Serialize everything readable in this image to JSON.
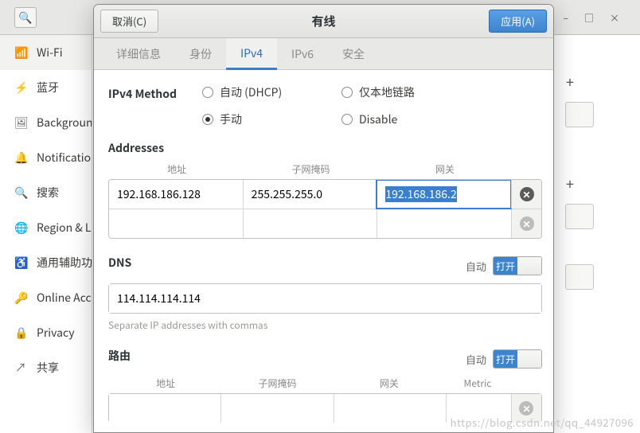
{
  "topbar": {
    "window_controls": {
      "min": "–",
      "max": "□",
      "close": "×"
    }
  },
  "sidebar": {
    "items": [
      {
        "icon": "📶",
        "label": "Wi-Fi"
      },
      {
        "icon": "⚡",
        "label": "蓝牙"
      },
      {
        "icon": "🖼",
        "label": "Background"
      },
      {
        "icon": "🔔",
        "label": "Notifications"
      },
      {
        "icon": "🔍",
        "label": "搜索"
      },
      {
        "icon": "🌐",
        "label": "Region & Language"
      },
      {
        "icon": "♿",
        "label": "通用辅助功能"
      },
      {
        "icon": "🔑",
        "label": "Online Accounts"
      },
      {
        "icon": "🔒",
        "label": "Privacy"
      },
      {
        "icon": "↗",
        "label": "共享"
      }
    ]
  },
  "dialog": {
    "cancel": "取消(C)",
    "title": "有线",
    "apply": "应用(A)",
    "tabs": [
      "详细信息",
      "身份",
      "IPv4",
      "IPv6",
      "安全"
    ],
    "active_tab": "IPv4"
  },
  "ipv4": {
    "method_label": "IPv4 Method",
    "methods": {
      "dhcp": "自动 (DHCP)",
      "local": "仅本地链路",
      "manual": "手动",
      "disable": "Disable"
    },
    "selected_method": "manual",
    "addresses_label": "Addresses",
    "addresses_cols": {
      "addr": "地址",
      "mask": "子网掩码",
      "gw": "网关"
    },
    "addresses": [
      {
        "addr": "192.168.186.128",
        "mask": "255.255.255.0",
        "gw": "192.168.186.2"
      },
      {
        "addr": "",
        "mask": "",
        "gw": ""
      }
    ],
    "dns_label": "DNS",
    "auto_label": "自动",
    "switch_on": "打开",
    "dns_value": "114.114.114.114",
    "dns_hint": "Separate IP addresses with commas",
    "route_label": "路由",
    "route_cols": {
      "addr": "地址",
      "mask": "子网掩码",
      "gw": "网关",
      "metric": "Metric"
    }
  },
  "watermark": "https://blog.csdn.net/qq_44927096"
}
